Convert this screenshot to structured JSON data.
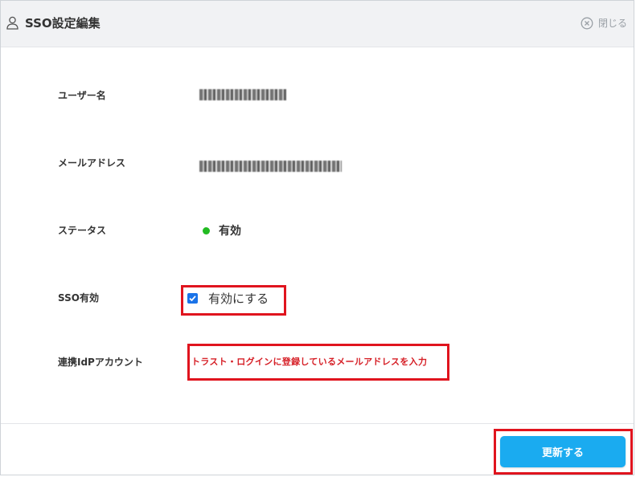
{
  "header": {
    "title": "SSO設定編集",
    "close_label": "閉じる"
  },
  "fields": {
    "username_label": "ユーザー名",
    "email_label": "メールアドレス",
    "status_label": "ステータス",
    "status_value": "有効",
    "sso_label": "SSO有効",
    "sso_checkbox_label": "有効にする",
    "sso_checked": true,
    "idp_label": "連携IdPアカウント",
    "idp_hint": "トラスト・ログインに登録しているメールアドレスを入力"
  },
  "footer": {
    "update_label": "更新する"
  },
  "colors": {
    "accent_button": "#1aabf0",
    "annotation_red": "#e0141e",
    "status_green": "#22bb22"
  }
}
